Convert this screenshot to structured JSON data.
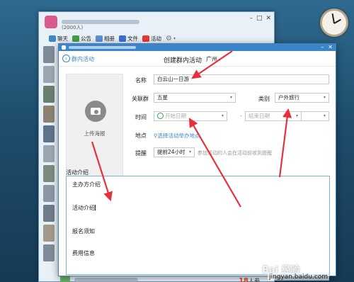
{
  "background_window": {
    "member_count_text": "(2000人)",
    "toolbar": [
      {
        "label": "聊天",
        "icon": "chat-icon",
        "color": "#3a86c8"
      },
      {
        "label": "公告",
        "icon": "flag-icon",
        "color": "#43a047"
      },
      {
        "label": "相册",
        "icon": "album-icon",
        "color": "#5b8fd0"
      },
      {
        "label": "文件",
        "icon": "folder-icon",
        "color": "#3a6fd8"
      },
      {
        "label": "活动",
        "icon": "activity-flag-icon",
        "color": "#e53935"
      }
    ],
    "count_prefix": "18",
    "count_suffix": "人参"
  },
  "dialog": {
    "heading": "创建群内活动",
    "back_label": "群内活动",
    "city": "广州",
    "poster_label": "上传海报",
    "fields": {
      "name_label": "名称",
      "name_value": "白云山一日游",
      "group_label": "关联群",
      "group_value": "五星",
      "category_label": "类别",
      "category_value": "户外旅行",
      "time_label": "时间",
      "start_placeholder": "开始日期",
      "end_placeholder": "结束日期",
      "location_label": "地点",
      "location_link": "选择活动举办地点",
      "remind_label": "提醒",
      "remind_value": "提前24小时",
      "remind_hint": "参加活动的人会在活动前收到提醒"
    },
    "intro": {
      "label": "活动介绍",
      "lines": [
        "主办方介绍",
        "活动介绍",
        "报名须知",
        "费用信息"
      ]
    }
  },
  "watermark": {
    "brand": "Bai 经验",
    "url": "jingyan.baidu.com"
  },
  "colors": {
    "accent": "#3a86c8",
    "arrow": "#e8303a"
  }
}
